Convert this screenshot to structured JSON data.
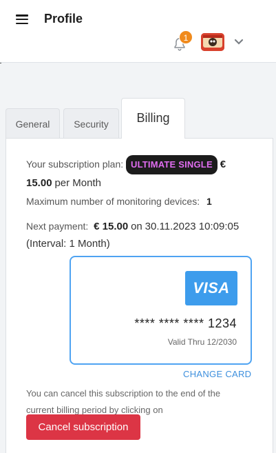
{
  "header": {
    "title": "Profile",
    "notification_count": "1",
    "menu_icon": "hamburger-menu-icon",
    "bell_icon": "bell-icon",
    "chevron_icon": "chevron-down-icon"
  },
  "tabs": [
    {
      "label": "General",
      "active": false
    },
    {
      "label": "Security",
      "active": false
    },
    {
      "label": "Billing",
      "active": true
    }
  ],
  "billing": {
    "plan_label": "Your subscription plan:",
    "plan_name": "ULTIMATE SINGLE",
    "price": "€ 15.00",
    "price_period": "per Month",
    "devices_label": "Maximum number of monitoring devices:",
    "devices_value": "1",
    "next_payment_label": "Next payment:",
    "next_payment_amount": "€ 15.00",
    "next_payment_on": "on",
    "next_payment_date": "30.11.2023 10:09:05",
    "interval": "(Interval: 1 Month)",
    "card": {
      "brand": "VISA",
      "number": "**** **** **** 1234",
      "valid": "Valid Thru 12/2030"
    },
    "change_card_label": "CHANGE CARD",
    "cancel_note_line1": "You can cancel this subscription to the end of the",
    "cancel_note_line2": "current billing period by clicking on",
    "cancel_button_label": "Cancel subscription"
  },
  "colors": {
    "accent_blue": "#3d9cec",
    "danger": "#dc3545",
    "badge_orange": "#f08a1c",
    "plan_badge_text": "#e06cf0"
  }
}
